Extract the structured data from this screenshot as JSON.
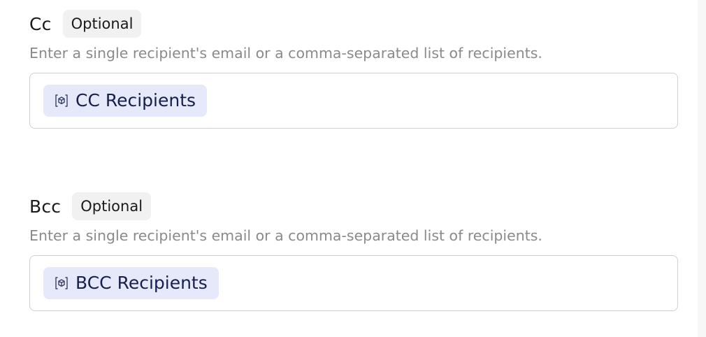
{
  "cc": {
    "label": "Cc",
    "badge": "Optional",
    "help_text": "Enter a single recipient's email or a comma-separated list of recipients.",
    "chip_label": "CC Recipients",
    "chip_icon": "variable-box-icon"
  },
  "bcc": {
    "label": "Bcc",
    "badge": "Optional",
    "help_text": "Enter a single recipient's email or a comma-separated list of recipients.",
    "chip_label": "BCC Recipients",
    "chip_icon": "variable-box-icon"
  },
  "colors": {
    "chip_bg": "#e5e9fa",
    "chip_text": "#17204a",
    "badge_bg": "#f1f1f2",
    "help_text": "#8a8a8e",
    "border": "#d0d0d4"
  }
}
